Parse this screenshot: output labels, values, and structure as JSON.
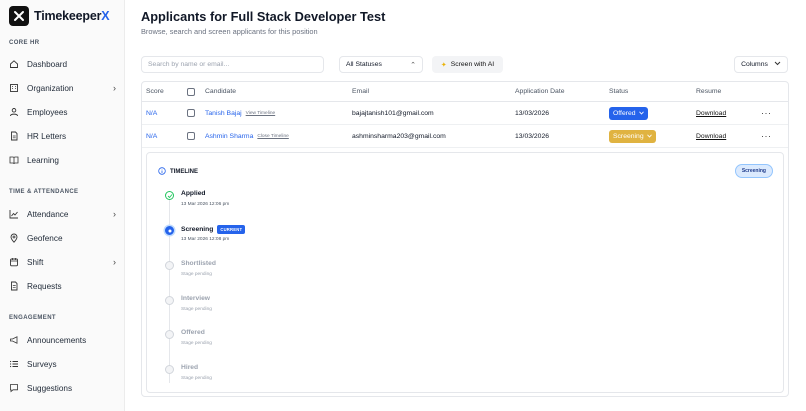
{
  "brand": {
    "name_main": "Timekeeper",
    "name_accent": "X"
  },
  "sidebar": {
    "sections": [
      {
        "label": "CORE HR",
        "items": [
          {
            "label": "Dashboard",
            "icon": "home-icon",
            "chevron": false
          },
          {
            "label": "Organization",
            "icon": "building-icon",
            "chevron": true
          },
          {
            "label": "Employees",
            "icon": "users-icon",
            "chevron": false
          },
          {
            "label": "HR Letters",
            "icon": "file-icon",
            "chevron": false
          },
          {
            "label": "Learning",
            "icon": "book-icon",
            "chevron": false
          }
        ]
      },
      {
        "label": "TIME & ATTENDANCE",
        "items": [
          {
            "label": "Attendance",
            "icon": "chart-icon",
            "chevron": true
          },
          {
            "label": "Geofence",
            "icon": "map-pin-icon",
            "chevron": false
          },
          {
            "label": "Shift",
            "icon": "calendar-icon",
            "chevron": true
          },
          {
            "label": "Requests",
            "icon": "document-icon",
            "chevron": false
          }
        ]
      },
      {
        "label": "ENGAGEMENT",
        "items": [
          {
            "label": "Announcements",
            "icon": "megaphone-icon",
            "chevron": false
          },
          {
            "label": "Surveys",
            "icon": "list-icon",
            "chevron": false
          },
          {
            "label": "Suggestions",
            "icon": "message-icon",
            "chevron": false
          }
        ]
      }
    ]
  },
  "page": {
    "title": "Applicants for Full Stack Developer Test",
    "subtitle": "Browse, search and screen applicants for this position"
  },
  "toolbar": {
    "search_placeholder": "Search by name or email...",
    "status_filter": "All Statuses",
    "ai_button": "Screen with AI",
    "columns_button": "Columns"
  },
  "table": {
    "headers": {
      "score": "Score",
      "candidate": "Candidate",
      "email": "Email",
      "date": "Application Date",
      "status": "Status",
      "resume": "Resume"
    },
    "rows": [
      {
        "score": "N/A",
        "name": "Tanish Bajaj",
        "timeline_link": "View Timeline",
        "email": "bajajtanish101@gmail.com",
        "date": "13/03/2026",
        "status": "Offered",
        "status_color": "#2563eb",
        "resume": "Download",
        "more": "···"
      },
      {
        "score": "N/A",
        "name": "Ashmin Sharma",
        "timeline_link": "Close Timeline",
        "email": "ashminsharma203@gmail.com",
        "date": "13/03/2026",
        "status": "Screening",
        "status_color": "#e0b341",
        "resume": "Download",
        "more": "···"
      }
    ]
  },
  "timeline": {
    "title": "TIMELINE",
    "badge": "Screening",
    "current_tag": "CURRENT",
    "stages": [
      {
        "name": "Applied",
        "meta": "13 Mar 2026 12:06 pm",
        "state": "done"
      },
      {
        "name": "Screening",
        "meta": "13 Mar 2026 12:08 pm",
        "state": "current"
      },
      {
        "name": "Shortlisted",
        "meta": "Stage pending",
        "state": "pending"
      },
      {
        "name": "Interview",
        "meta": "Stage pending",
        "state": "pending"
      },
      {
        "name": "Offered",
        "meta": "Stage pending",
        "state": "pending"
      },
      {
        "name": "Hired",
        "meta": "Stage pending",
        "state": "pending"
      }
    ]
  }
}
